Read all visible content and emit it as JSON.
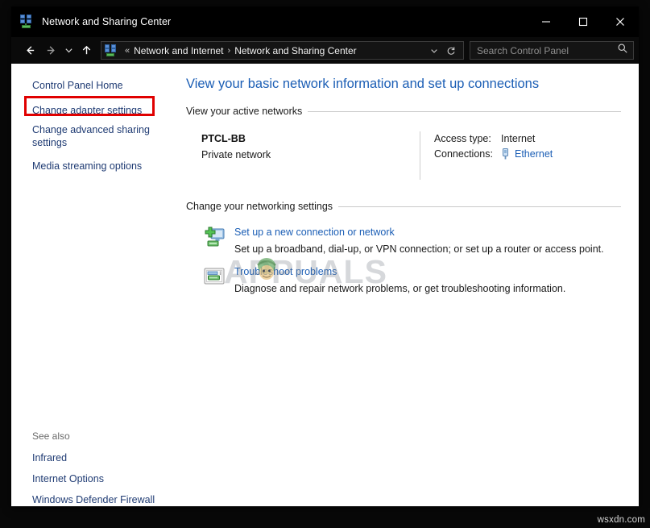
{
  "window": {
    "title": "Network and Sharing Center",
    "icon": "network-sharing-center-icon",
    "controls": {
      "minimize": "minimize-icon",
      "maximize": "maximize-icon",
      "close": "close-icon"
    }
  },
  "navbar": {
    "back": "back-arrow-icon",
    "forward": "forward-arrow-icon",
    "recent": "chevron-down-icon",
    "up": "up-arrow-icon",
    "address_icon": "network-sharing-center-icon",
    "overflow": "«",
    "crumbs": [
      "Network and Internet",
      "Network and Sharing Center"
    ],
    "crumb_separator": "›",
    "dropdown": "chevron-down-icon",
    "refresh": "refresh-icon",
    "search": {
      "placeholder": "Search Control Panel",
      "value": "",
      "icon": "search-icon"
    }
  },
  "sidebar": {
    "items": [
      {
        "label": "Control Panel Home",
        "highlighted": false
      },
      {
        "label": "Change adapter settings",
        "highlighted": true
      },
      {
        "label": "Change advanced sharing settings",
        "highlighted": false
      },
      {
        "label": "Media streaming options",
        "highlighted": false
      }
    ],
    "see_also": {
      "title": "See also",
      "items": [
        {
          "label": "Infrared"
        },
        {
          "label": "Internet Options"
        },
        {
          "label": "Windows Defender Firewall"
        }
      ]
    },
    "highlight_color": "#e00000"
  },
  "content": {
    "page_title": "View your basic network information and set up connections",
    "active_networks": {
      "heading": "View your active networks",
      "network_name": "PTCL-BB",
      "network_type": "Private network",
      "details": [
        {
          "key": "Access type:",
          "value": "Internet",
          "is_link": false,
          "icon": ""
        },
        {
          "key": "Connections:",
          "value": "Ethernet",
          "is_link": true,
          "icon": "ethernet-plug-icon"
        }
      ]
    },
    "networking_settings": {
      "heading": "Change your networking settings",
      "items": [
        {
          "icon": "new-connection-icon",
          "link": "Set up a new connection or network",
          "description": "Set up a broadband, dial-up, or VPN connection; or set up a router or access point."
        },
        {
          "icon": "troubleshoot-icon",
          "link": "Troubleshoot problems",
          "description": "Diagnose and repair network problems, or get troubleshooting information."
        }
      ]
    }
  },
  "watermark": {
    "text": "APPUALS",
    "logo": "appuals-logo-icon"
  },
  "site_tag": "wsxdn.com",
  "colors": {
    "link": "#1b5eb5",
    "sidebar_link": "#1f3b73",
    "highlight": "#e00000",
    "titlebar_bg": "#000000"
  }
}
